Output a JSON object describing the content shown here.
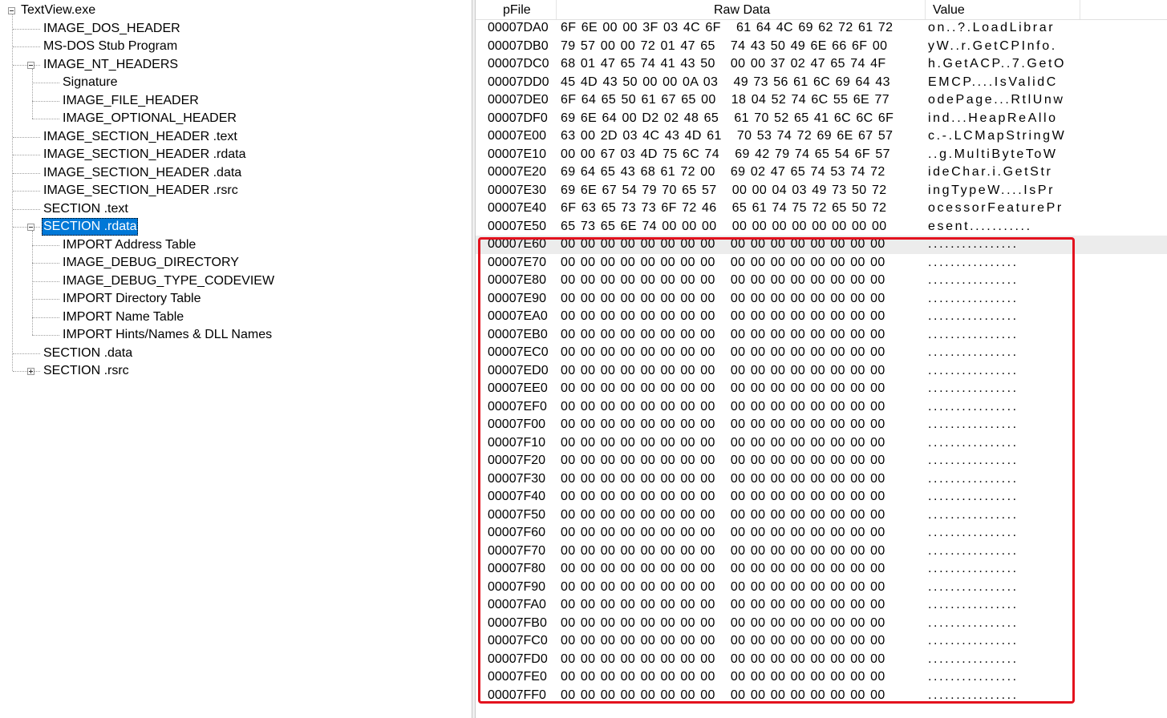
{
  "tree": {
    "root": "TextView.exe",
    "items": [
      {
        "label": "IMAGE_DOS_HEADER",
        "level": 1
      },
      {
        "label": "MS-DOS Stub Program",
        "level": 1
      },
      {
        "label": "IMAGE_NT_HEADERS",
        "level": 1,
        "expander": "minus"
      },
      {
        "label": "Signature",
        "level": 2
      },
      {
        "label": "IMAGE_FILE_HEADER",
        "level": 2
      },
      {
        "label": "IMAGE_OPTIONAL_HEADER",
        "level": 2
      },
      {
        "label": "IMAGE_SECTION_HEADER .text",
        "level": 1
      },
      {
        "label": "IMAGE_SECTION_HEADER .rdata",
        "level": 1
      },
      {
        "label": "IMAGE_SECTION_HEADER .data",
        "level": 1
      },
      {
        "label": "IMAGE_SECTION_HEADER .rsrc",
        "level": 1
      },
      {
        "label": "SECTION .text",
        "level": 1
      },
      {
        "label": "SECTION .rdata",
        "level": 1,
        "expander": "minus",
        "selected": true
      },
      {
        "label": "IMPORT Address Table",
        "level": 2
      },
      {
        "label": "IMAGE_DEBUG_DIRECTORY",
        "level": 2
      },
      {
        "label": "IMAGE_DEBUG_TYPE_CODEVIEW",
        "level": 2
      },
      {
        "label": "IMPORT Directory Table",
        "level": 2
      },
      {
        "label": "IMPORT Name Table",
        "level": 2
      },
      {
        "label": "IMPORT Hints/Names & DLL Names",
        "level": 2
      },
      {
        "label": "SECTION .data",
        "level": 1
      },
      {
        "label": "SECTION .rsrc",
        "level": 1,
        "expander": "plus"
      }
    ]
  },
  "hex": {
    "headers": {
      "pfile": "pFile",
      "raw": "Raw Data",
      "value": "Value"
    },
    "rows": [
      {
        "addr": "00007DA0",
        "bytes": "6F 6E 00 00 3F 03 4C 6F   61 64 4C 69 62 72 61 72",
        "value": "on..?.LoadLibrar"
      },
      {
        "addr": "00007DB0",
        "bytes": "79 57 00 00 72 01 47 65   74 43 50 49 6E 66 6F 00",
        "value": "yW..r.GetCPInfo."
      },
      {
        "addr": "00007DC0",
        "bytes": "68 01 47 65 74 41 43 50   00 00 37 02 47 65 74 4F",
        "value": "h.GetACP..7.GetO"
      },
      {
        "addr": "00007DD0",
        "bytes": "45 4D 43 50 00 00 0A 03   49 73 56 61 6C 69 64 43",
        "value": "EMCP....IsValidC"
      },
      {
        "addr": "00007DE0",
        "bytes": "6F 64 65 50 61 67 65 00   18 04 52 74 6C 55 6E 77",
        "value": "odePage...RtlUnw"
      },
      {
        "addr": "00007DF0",
        "bytes": "69 6E 64 00 D2 02 48 65   61 70 52 65 41 6C 6C 6F",
        "value": "ind...HeapReAllo"
      },
      {
        "addr": "00007E00",
        "bytes": "63 00 2D 03 4C 43 4D 61   70 53 74 72 69 6E 67 57",
        "value": "c.-.LCMapStringW"
      },
      {
        "addr": "00007E10",
        "bytes": "00 00 67 03 4D 75 6C 74   69 42 79 74 65 54 6F 57",
        "value": "..g.MultiByteToW"
      },
      {
        "addr": "00007E20",
        "bytes": "69 64 65 43 68 61 72 00   69 02 47 65 74 53 74 72",
        "value": "ideChar.i.GetStr"
      },
      {
        "addr": "00007E30",
        "bytes": "69 6E 67 54 79 70 65 57   00 00 04 03 49 73 50 72",
        "value": "ingTypeW....IsPr"
      },
      {
        "addr": "00007E40",
        "bytes": "6F 63 65 73 73 6F 72 46   65 61 74 75 72 65 50 72",
        "value": "ocessorFeaturePr"
      },
      {
        "addr": "00007E50",
        "bytes": "65 73 65 6E 74 00 00 00   00 00 00 00 00 00 00 00",
        "value": "esent..........."
      },
      {
        "addr": "00007E60",
        "bytes": "00 00 00 00 00 00 00 00   00 00 00 00 00 00 00 00",
        "value": "................",
        "highlighted": true
      },
      {
        "addr": "00007E70",
        "bytes": "00 00 00 00 00 00 00 00   00 00 00 00 00 00 00 00",
        "value": "................"
      },
      {
        "addr": "00007E80",
        "bytes": "00 00 00 00 00 00 00 00   00 00 00 00 00 00 00 00",
        "value": "................"
      },
      {
        "addr": "00007E90",
        "bytes": "00 00 00 00 00 00 00 00   00 00 00 00 00 00 00 00",
        "value": "................"
      },
      {
        "addr": "00007EA0",
        "bytes": "00 00 00 00 00 00 00 00   00 00 00 00 00 00 00 00",
        "value": "................"
      },
      {
        "addr": "00007EB0",
        "bytes": "00 00 00 00 00 00 00 00   00 00 00 00 00 00 00 00",
        "value": "................"
      },
      {
        "addr": "00007EC0",
        "bytes": "00 00 00 00 00 00 00 00   00 00 00 00 00 00 00 00",
        "value": "................"
      },
      {
        "addr": "00007ED0",
        "bytes": "00 00 00 00 00 00 00 00   00 00 00 00 00 00 00 00",
        "value": "................"
      },
      {
        "addr": "00007EE0",
        "bytes": "00 00 00 00 00 00 00 00   00 00 00 00 00 00 00 00",
        "value": "................"
      },
      {
        "addr": "00007EF0",
        "bytes": "00 00 00 00 00 00 00 00   00 00 00 00 00 00 00 00",
        "value": "................"
      },
      {
        "addr": "00007F00",
        "bytes": "00 00 00 00 00 00 00 00   00 00 00 00 00 00 00 00",
        "value": "................"
      },
      {
        "addr": "00007F10",
        "bytes": "00 00 00 00 00 00 00 00   00 00 00 00 00 00 00 00",
        "value": "................"
      },
      {
        "addr": "00007F20",
        "bytes": "00 00 00 00 00 00 00 00   00 00 00 00 00 00 00 00",
        "value": "................"
      },
      {
        "addr": "00007F30",
        "bytes": "00 00 00 00 00 00 00 00   00 00 00 00 00 00 00 00",
        "value": "................"
      },
      {
        "addr": "00007F40",
        "bytes": "00 00 00 00 00 00 00 00   00 00 00 00 00 00 00 00",
        "value": "................"
      },
      {
        "addr": "00007F50",
        "bytes": "00 00 00 00 00 00 00 00   00 00 00 00 00 00 00 00",
        "value": "................"
      },
      {
        "addr": "00007F60",
        "bytes": "00 00 00 00 00 00 00 00   00 00 00 00 00 00 00 00",
        "value": "................"
      },
      {
        "addr": "00007F70",
        "bytes": "00 00 00 00 00 00 00 00   00 00 00 00 00 00 00 00",
        "value": "................"
      },
      {
        "addr": "00007F80",
        "bytes": "00 00 00 00 00 00 00 00   00 00 00 00 00 00 00 00",
        "value": "................"
      },
      {
        "addr": "00007F90",
        "bytes": "00 00 00 00 00 00 00 00   00 00 00 00 00 00 00 00",
        "value": "................"
      },
      {
        "addr": "00007FA0",
        "bytes": "00 00 00 00 00 00 00 00   00 00 00 00 00 00 00 00",
        "value": "................"
      },
      {
        "addr": "00007FB0",
        "bytes": "00 00 00 00 00 00 00 00   00 00 00 00 00 00 00 00",
        "value": "................"
      },
      {
        "addr": "00007FC0",
        "bytes": "00 00 00 00 00 00 00 00   00 00 00 00 00 00 00 00",
        "value": "................"
      },
      {
        "addr": "00007FD0",
        "bytes": "00 00 00 00 00 00 00 00   00 00 00 00 00 00 00 00",
        "value": "................"
      },
      {
        "addr": "00007FE0",
        "bytes": "00 00 00 00 00 00 00 00   00 00 00 00 00 00 00 00",
        "value": "................"
      },
      {
        "addr": "00007FF0",
        "bytes": "00 00 00 00 00 00 00 00   00 00 00 00 00 00 00 00",
        "value": "................"
      }
    ]
  },
  "annotation": {
    "color": "#e3121e"
  }
}
